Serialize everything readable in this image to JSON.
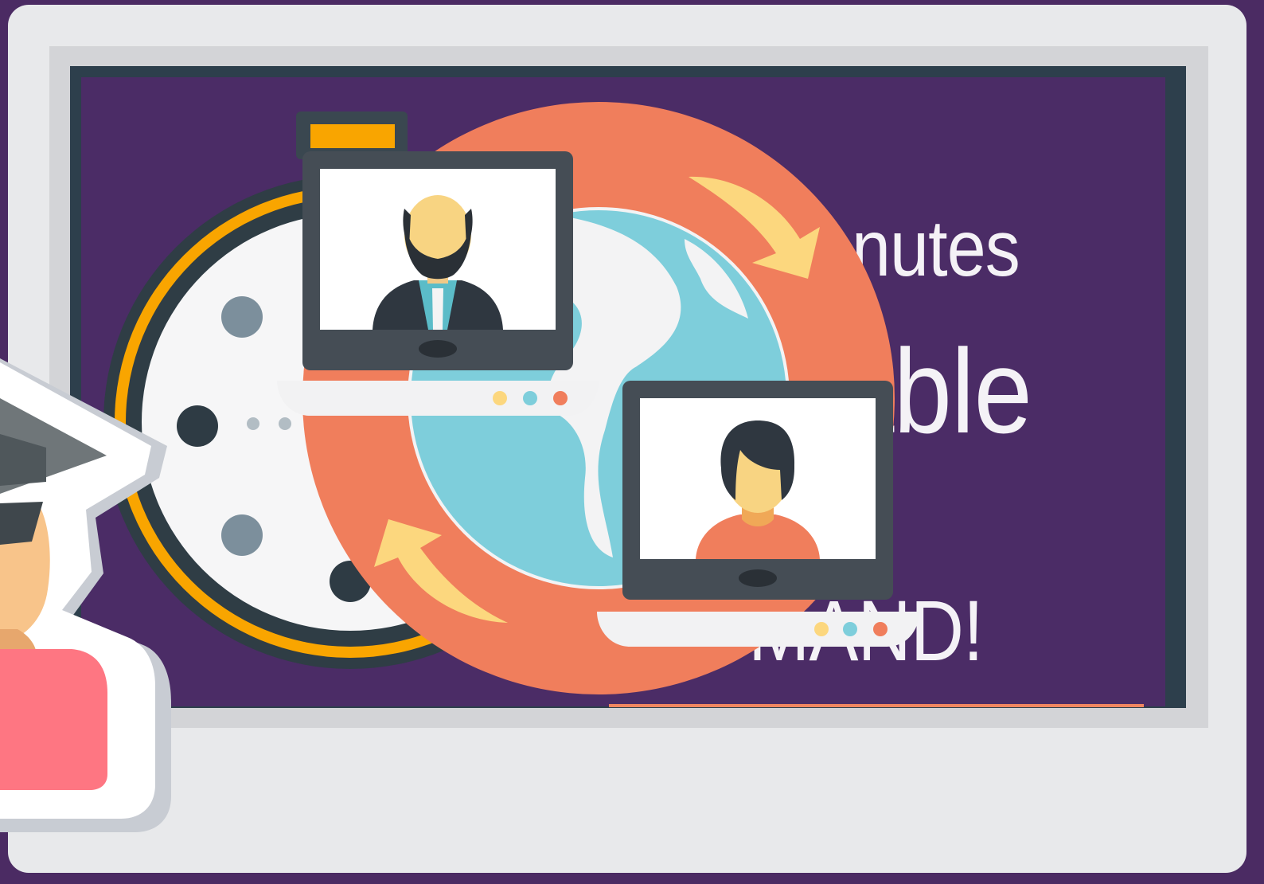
{
  "slide": {
    "line_1": "nutes",
    "line_2": "able",
    "line_3": "MAND!"
  },
  "icons": {
    "stopwatch": "stopwatch-icon",
    "globe": "globe-icon",
    "cycle_arrows": "sync-arrows-icon",
    "laptop_man": "laptop-video-call-man-icon",
    "laptop_woman": "laptop-video-call-woman-icon",
    "graduate": "graduate-student-sticker-icon"
  },
  "colors": {
    "background": "#4b2b63",
    "screen": "#4b2c66",
    "orange_ring": "#f07e5c",
    "globe_water": "#7ecedb",
    "arrows": "#fcd77e",
    "stopwatch_rim": "#f9a500",
    "laptop": "#454d55"
  }
}
